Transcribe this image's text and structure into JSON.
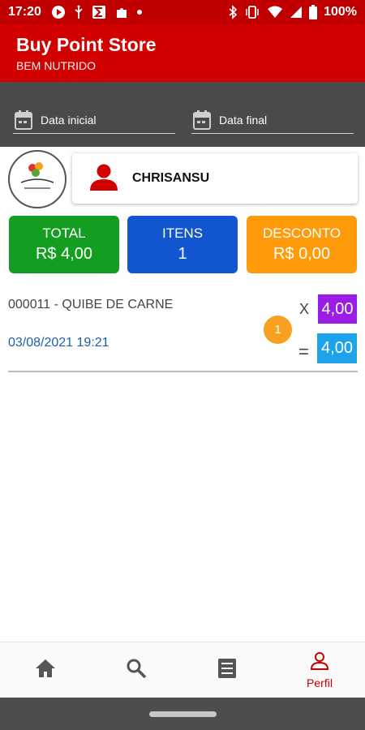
{
  "status_bar": {
    "time": "17:20",
    "battery": "100%"
  },
  "app_bar": {
    "title": "Buy Point Store",
    "subtitle": "BEM NUTRIDO"
  },
  "filters": {
    "start_date_label": "Data inicial",
    "end_date_label": "Data final"
  },
  "user": {
    "name": "CHRISANSU"
  },
  "summary": {
    "total_label": "TOTAL",
    "total_value": "R$ 4,00",
    "itens_label": "ITENS",
    "itens_value": "1",
    "desconto_label": "DESCONTO",
    "desconto_value": "R$ 0,00"
  },
  "items": [
    {
      "name": "000011 - QUIBE DE CARNE",
      "datetime": "03/08/2021 19:21",
      "quantity": "1",
      "times": "X",
      "price": "4,00",
      "equals": "=",
      "subtotal": "4,00"
    }
  ],
  "bottom_nav": {
    "active_label": "Perfil"
  },
  "colors": {
    "status_bar": "#c00000",
    "app_bar": "#d30000",
    "filter_bar": "#4a4a4a",
    "total_card": "#139e21",
    "itens_card": "#1255d0",
    "desconto_card": "#ff9b0b",
    "qty_badge": "#f7a021",
    "price_box": "#9b1ce6",
    "subtotal_box": "#1ca3ea"
  }
}
